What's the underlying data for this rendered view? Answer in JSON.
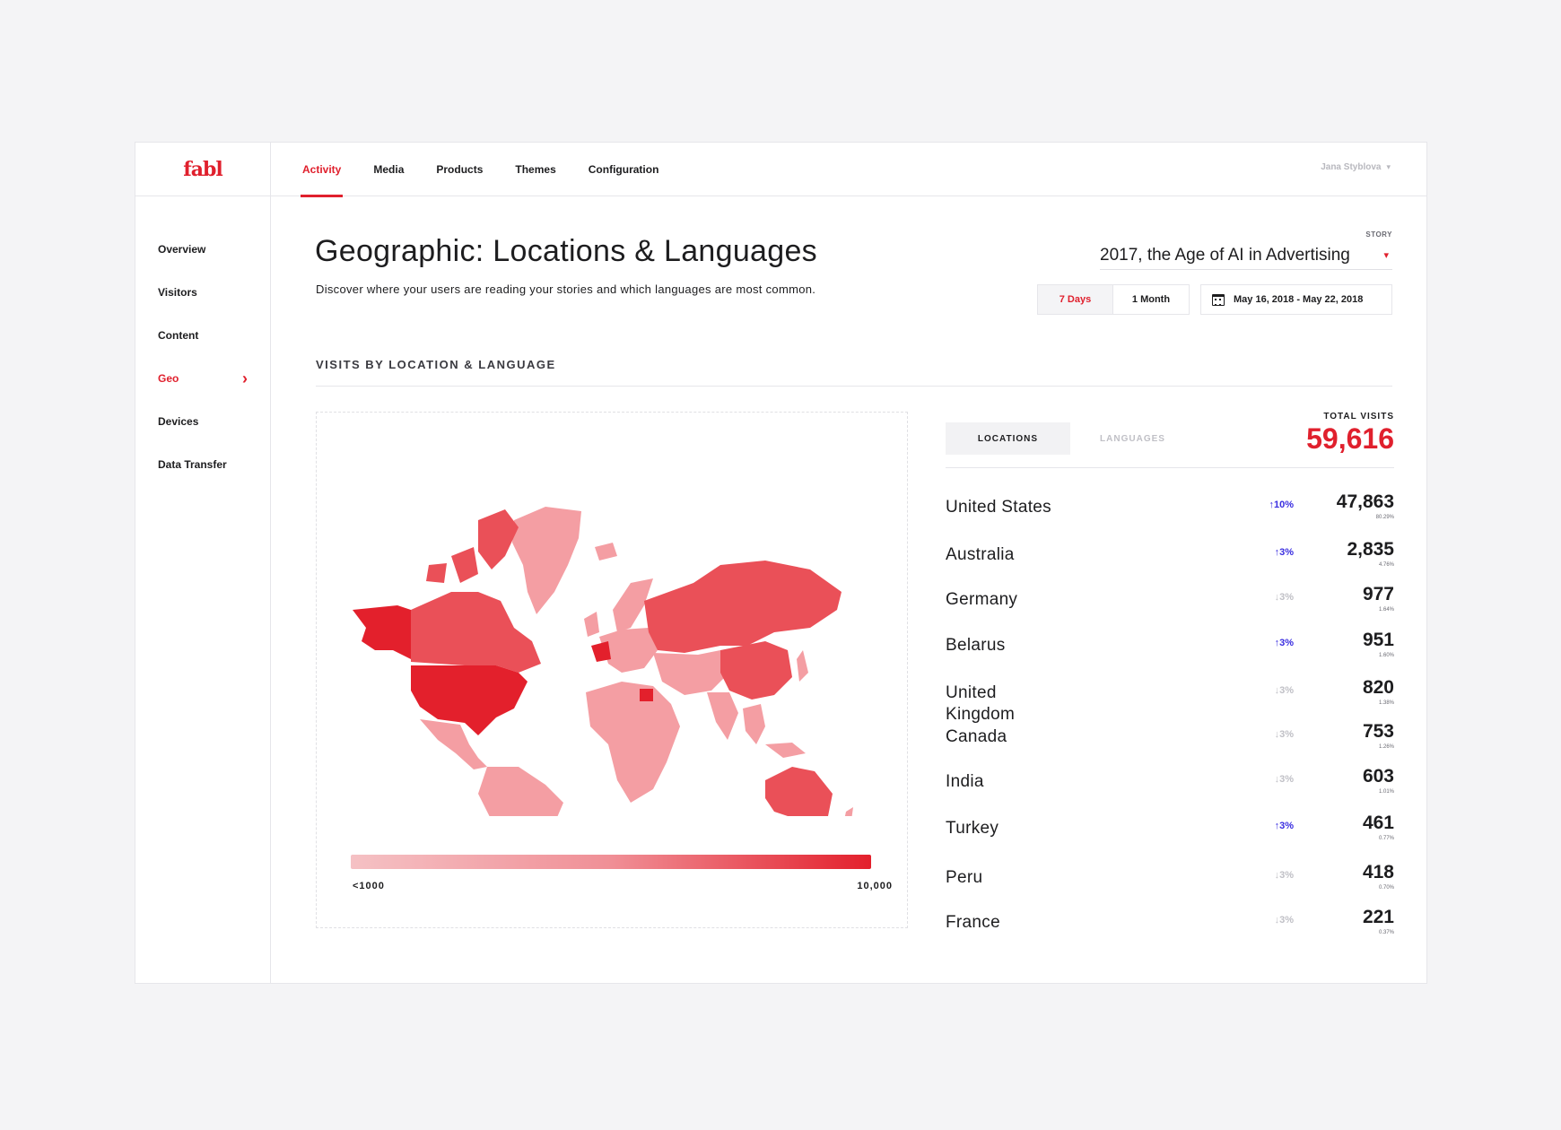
{
  "brand": {
    "logo_text": "fabl"
  },
  "sidebar": {
    "items": [
      {
        "label": "Overview"
      },
      {
        "label": "Visitors"
      },
      {
        "label": "Content"
      },
      {
        "label": "Geo",
        "chevron": "›"
      },
      {
        "label": "Devices"
      },
      {
        "label": "Data Transfer"
      }
    ]
  },
  "topnav": {
    "tabs": [
      {
        "label": "Activity"
      },
      {
        "label": "Media"
      },
      {
        "label": "Products"
      },
      {
        "label": "Themes"
      },
      {
        "label": "Configuration"
      }
    ],
    "user_name": "Jana Styblova",
    "user_caret": "▾"
  },
  "page": {
    "title": "Geographic: Locations & Languages",
    "description": "Discover where your users are reading your stories and which languages are most common."
  },
  "story": {
    "label": "STORY",
    "value": "2017, the Age of AI in Advertising",
    "caret": "▾"
  },
  "range": {
    "options": [
      "7 Days",
      "1 Month"
    ],
    "date_range": "May 16, 2018 - May 22, 2018"
  },
  "section": {
    "title": "VISITS BY LOCATION & LANGUAGE"
  },
  "map": {
    "legend_min": "<1000",
    "legend_max": "10,000",
    "colors": {
      "low": "#f5c1c4",
      "mid": "#f08f96",
      "high": "#e3202c",
      "accent": "#e0202d",
      "up": "#3a2ee0"
    }
  },
  "panel": {
    "tabs": [
      "LOCATIONS",
      "LANGUAGES"
    ],
    "total_label": "TOTAL VISITS",
    "total_value": "59,616",
    "rows": [
      {
        "country": "United States",
        "change": "↑10%",
        "direction": "up",
        "value": "47,863",
        "pct": "80.29%"
      },
      {
        "country": "Australia",
        "change": "↑3%",
        "direction": "up",
        "value": "2,835",
        "pct": "4.76%"
      },
      {
        "country": "Germany",
        "change": "↓3%",
        "direction": "down",
        "value": "977",
        "pct": "1.64%"
      },
      {
        "country": "Belarus",
        "change": "↑3%",
        "direction": "up",
        "value": "951",
        "pct": "1.60%"
      },
      {
        "country": "United Kingdom",
        "change": "↓3%",
        "direction": "down",
        "value": "820",
        "pct": "1.38%"
      },
      {
        "country": "Canada",
        "change": "↓3%",
        "direction": "down",
        "value": "753",
        "pct": "1.26%"
      },
      {
        "country": "India",
        "change": "↓3%",
        "direction": "down",
        "value": "603",
        "pct": "1.01%"
      },
      {
        "country": "Turkey",
        "change": "↑3%",
        "direction": "up",
        "value": "461",
        "pct": "0.77%"
      },
      {
        "country": "Peru",
        "change": "↓3%",
        "direction": "down",
        "value": "418",
        "pct": "0.70%"
      },
      {
        "country": "France",
        "change": "↓3%",
        "direction": "down",
        "value": "221",
        "pct": "0.37%"
      }
    ]
  }
}
